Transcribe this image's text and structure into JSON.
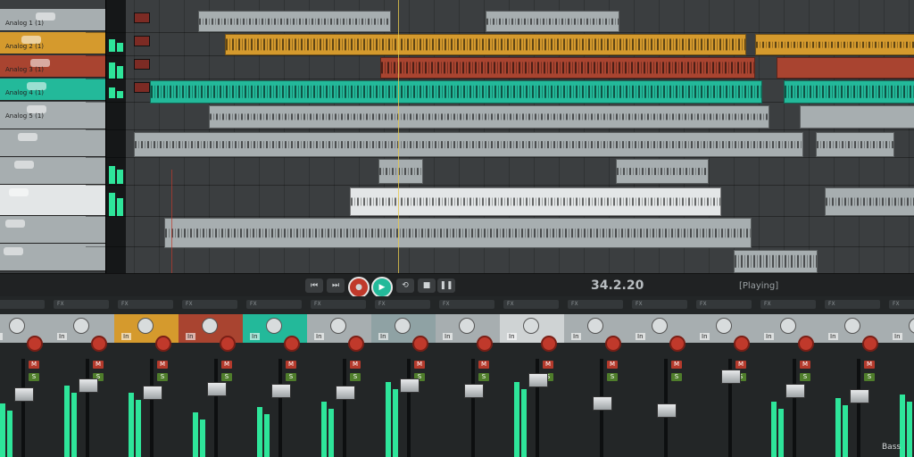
{
  "arrange": {
    "track_names": [
      "Analog 1 (1)",
      "Analog 2 (1)",
      "Analog 3 (1)",
      "Analog 4 (1)",
      "Analog 5 (1)"
    ],
    "colors": {
      "orange": "#d59a2d",
      "red": "#a94430",
      "teal": "#23b99a",
      "grey": "#a7aeb0",
      "white": "#e3e6e7",
      "dark": "#3b3e40"
    }
  },
  "transport": {
    "buttons": [
      "skip-back-icon",
      "play-back-icon",
      "record-icon",
      "play-icon",
      "loop-icon",
      "stop-icon",
      "pause-icon"
    ],
    "time": "34.2.20",
    "status": "[Playing]"
  },
  "mixer": {
    "fx_label": "FX",
    "in_label": "In",
    "mute_label": "M",
    "solo_label": "S",
    "channel_label": "Bass",
    "strip_colors": [
      "#a7aeb0",
      "#a7aeb0",
      "#d59a2d",
      "#a94430",
      "#23b99a",
      "#a7aeb0",
      "#8fa2a4",
      "#a7aeb0",
      "#cfd3d4",
      "#a7aeb0",
      "#a7aeb0",
      "#a7aeb0",
      "#a7aeb0",
      "#a7aeb0",
      "#a7aeb0"
    ]
  }
}
